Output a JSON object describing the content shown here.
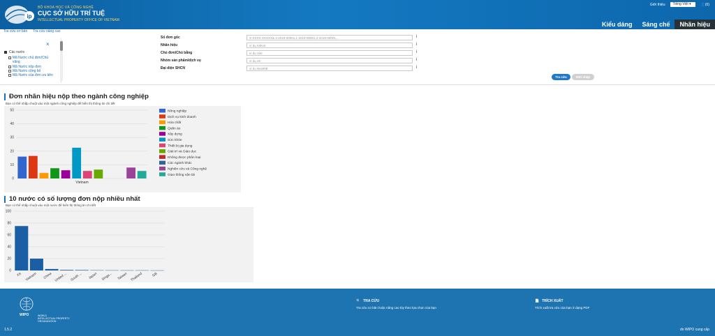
{
  "header": {
    "brand_small": "BỘ KHOA HỌC VÀ CÔNG NGHỆ",
    "brand_main": "CỤC SỞ HỮU TRÍ TUỆ",
    "brand_en": "INTELLECTUAL PROPERTY OFFICE OF VIETNAM",
    "logo_text": "ip",
    "intro_link": "Giới thiệu",
    "language": "Tiếng Việt",
    "user_label": "(0)",
    "tabs": [
      {
        "label": "Kiểu dáng"
      },
      {
        "label": "Sáng chế"
      },
      {
        "label": "Nhãn hiệu"
      }
    ]
  },
  "left": {
    "link_basic": "Tra cứu cơ bản",
    "link_advanced": "Tra cứu nâng cao",
    "close_icon": "×",
    "panel_title": "Các nước",
    "options": [
      "Mã Nước chủ đơn/Chủ văng",
      "Mã Nước nộp đơn",
      "Mã Nước công bố",
      "Mã Nước của đơn ưu tiên"
    ]
  },
  "form": {
    "fields": [
      {
        "label": "Số đơn gốc",
        "placeholder": "X-XXXX-XXXXX& 4-2019-00001,1-2019-00001,3-2019-00001,..."
      },
      {
        "label": "Nhãn hiệu",
        "placeholder": "ví dụ KitKat"
      },
      {
        "label": "Chủ đơn/Chủ bằng",
        "placeholder": "ví dụ Viet"
      },
      {
        "label": "Nhóm sản phẩm/dịch vụ",
        "placeholder": "ví dụ 25"
      },
      {
        "label": "Đại diện SHCN",
        "placeholder": "ví dụ NestRB"
      }
    ],
    "info_icon": "i",
    "search_button": "Tra cứu",
    "clear_button": "Mới nhập"
  },
  "section1": {
    "title": "Đơn nhãn hiệu nộp theo ngành công nghiệp",
    "subtitle": "Bạn có thể nhấp chuột vào một ngành công nghiệp để hiển thị thông tin chi tiết"
  },
  "section2": {
    "title": "10 nước có số lượng đơn nộp nhiều nhất",
    "subtitle": "Bạn có thể nhấp chuột vào một nước để hiển thị thông tin chi tiết"
  },
  "chart_data": [
    {
      "type": "bar",
      "categories": [
        "Vietnam"
      ],
      "ylim": [
        0,
        50
      ],
      "yticks": [
        0,
        10,
        20,
        30,
        40,
        50
      ],
      "legend_position": "right",
      "grid": true,
      "series": [
        {
          "name": "Nông nghiệp",
          "color": "#3366cc",
          "values": [
            16
          ]
        },
        {
          "name": "Dịch vụ kinh doanh",
          "color": "#dc3912",
          "values": [
            16.5
          ]
        },
        {
          "name": "Hóa chất",
          "color": "#ff9900",
          "values": [
            4
          ]
        },
        {
          "name": "Quần áo",
          "color": "#109618",
          "values": [
            7.5
          ]
        },
        {
          "name": "Xây dựng",
          "color": "#990099",
          "values": [
            6
          ]
        },
        {
          "name": "Sức khỏe",
          "color": "#0099c6",
          "values": [
            22.5
          ]
        },
        {
          "name": "Thiết bị gia dụng",
          "color": "#dd4477",
          "values": [
            5.5
          ]
        },
        {
          "name": "Giải trí và Giáo dục",
          "color": "#66aa00",
          "values": [
            6.5
          ]
        },
        {
          "name": "Không được phân loại",
          "color": "#b82e2e",
          "values": [
            0
          ]
        },
        {
          "name": "Các ngành khác",
          "color": "#316395",
          "values": [
            0
          ]
        },
        {
          "name": "Nghiên cứu và Công nghệ",
          "color": "#994499",
          "values": [
            8
          ]
        },
        {
          "name": "Giao thông vận tải",
          "color": "#22aa99",
          "values": [
            5.5
          ]
        }
      ]
    },
    {
      "type": "bar",
      "categories": [
        "XX",
        "Vietnam",
        "China",
        "United ...",
        "South ...",
        "Japan",
        "Singa...",
        "Taiwan",
        "Thailand",
        "GB"
      ],
      "values": [
        75,
        20,
        2.5,
        1,
        0.8,
        0.5,
        0.4,
        0.3,
        0.3,
        0.2
      ],
      "color": "#1a5fa4",
      "ylim": [
        0,
        100
      ],
      "yticks": [
        0,
        20,
        40,
        60,
        80,
        100
      ],
      "grid": true
    }
  ],
  "footer": {
    "wipo": "WIPO",
    "wipo_sub_1": "WORLD",
    "wipo_sub_2": "INTELLECTUAL PROPERTY",
    "wipo_sub_3": "ORGANIZATION",
    "col1_title": "TRA CỨU",
    "col1_desc": "Tra cứu cơ bản hoặc nâng cao tùy theo lựa chọn của bạn",
    "col2_title": "TRÍCH XUẤT",
    "col2_desc": "Trích xuất tra cứu của bạn ở dạng PDF",
    "version": "1.5.2",
    "provided_by": "do WIPO cung cấp"
  }
}
